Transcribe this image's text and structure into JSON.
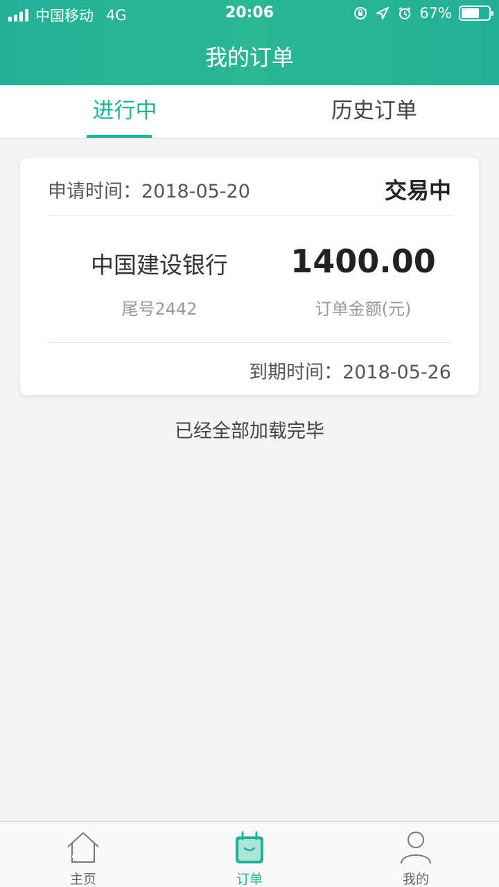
{
  "status_bar": {
    "carrier": "中国移动",
    "network": "4G",
    "time": "20:06",
    "battery_text": "67%",
    "battery_level": 0.67,
    "icons": [
      "rotation-lock-icon",
      "location-arrow-icon",
      "alarm-clock-icon"
    ]
  },
  "header": {
    "title": "我的订单"
  },
  "tabs": [
    {
      "label": "进行中",
      "active": true
    },
    {
      "label": "历史订单",
      "active": false
    }
  ],
  "order": {
    "apply_time_label": "申请时间：",
    "apply_time": "2018-05-20",
    "status": "交易中",
    "bank_name": "中国建设银行",
    "card_tail": "尾号2442",
    "amount": "1400.00",
    "amount_label": "订单金额(元)",
    "due_time_label": "到期时间：",
    "due_time": "2018-05-26"
  },
  "list_footer": "已经全部加载完毕",
  "bottom_nav": [
    {
      "label": "主页",
      "icon": "home-icon",
      "active": false
    },
    {
      "label": "订单",
      "icon": "order-bag-icon",
      "active": true
    },
    {
      "label": "我的",
      "icon": "user-icon",
      "active": false
    }
  ],
  "colors": {
    "brand": "#22b196",
    "background": "#f4f4f4"
  }
}
